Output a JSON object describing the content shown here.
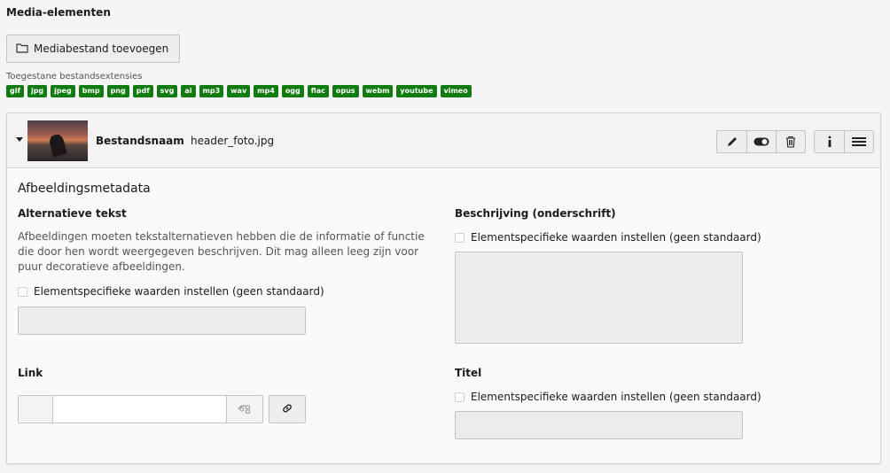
{
  "section": {
    "title": "Media-elementen"
  },
  "add_button": {
    "label": "Mediabestand toevoegen",
    "icon": "folder-icon"
  },
  "extensions": {
    "label": "Toegestane bestandsextensies",
    "badge_color": "#107c10",
    "items": [
      "gif",
      "jpg",
      "jpeg",
      "bmp",
      "png",
      "pdf",
      "svg",
      "ai",
      "mp3",
      "wav",
      "mp4",
      "ogg",
      "flac",
      "opus",
      "webm",
      "youtube",
      "vimeo"
    ]
  },
  "file": {
    "name_label": "Bestandsnaam",
    "name_value": "header_foto.jpg",
    "actions": [
      "pencil-icon",
      "toggle-icon",
      "trash-icon",
      "info-icon",
      "menu-icon"
    ]
  },
  "metadata": {
    "title": "Afbeeldingsmetadata",
    "alt": {
      "label": "Alternatieve tekst",
      "help": "Afbeeldingen moeten tekstalternatieven hebben die de informatie of functie die door hen wordt weergegeven beschrijven. Dit mag alleen leeg zijn voor puur decoratieve afbeeldingen.",
      "override_label": "Elementspecifieke waarden instellen (geen standaard)"
    },
    "description": {
      "label": "Beschrijving (onderschrift)",
      "override_label": "Elementspecifieke waarden instellen (geen standaard)"
    },
    "link": {
      "label": "Link",
      "value": ""
    },
    "title_field": {
      "label": "Titel",
      "override_label": "Elementspecifieke waarden instellen (geen standaard)"
    }
  }
}
